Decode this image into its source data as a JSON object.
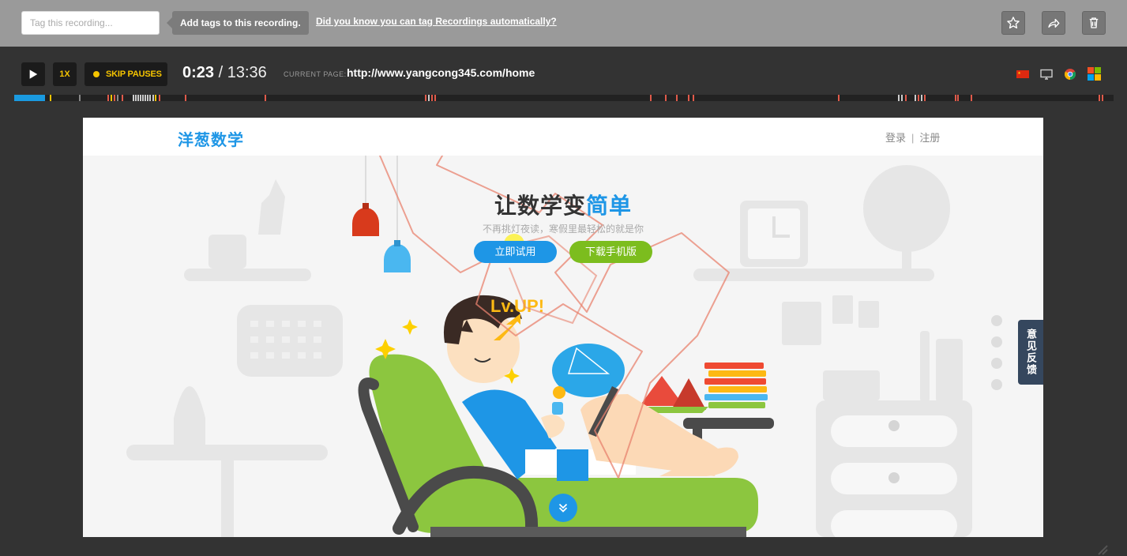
{
  "tagbar": {
    "input_placeholder": "Tag this recording...",
    "tooltip": "Add tags to this recording.",
    "auto_tag_link": "Did you know you can tag Recordings automatically?"
  },
  "controls": {
    "speed": "1X",
    "skip_pauses": "SKIP PAUSES",
    "current_time": "0:23",
    "separator": " / ",
    "total_time": "13:36",
    "current_page_label": "CURRENT PAGE:",
    "current_page_url": "http://www.yangcong345.com/home",
    "playback_progress_fraction": 0.028
  },
  "environment_icons": [
    "china-flag-icon",
    "desktop-icon",
    "chrome-icon",
    "windows-icon"
  ],
  "colors": {
    "accent_yellow": "#f5c400",
    "progress_blue": "#1a9ae0",
    "site_blue": "#1e96e6",
    "site_green": "#7cbd1e",
    "event_red": "#e05a4a"
  },
  "site": {
    "logo": "洋葱数学",
    "nav_login": "登录",
    "nav_separator": "|",
    "nav_register": "注册",
    "hero_title_main": "让数学变",
    "hero_title_highlight": "简单",
    "hero_subtitle": "不再挑灯夜读，寒假里最轻松的就是你",
    "btn_try": "立即试用",
    "btn_download": "下载手机版",
    "feedback": "意见反馈",
    "lvup_text": "Lv.UP!"
  }
}
